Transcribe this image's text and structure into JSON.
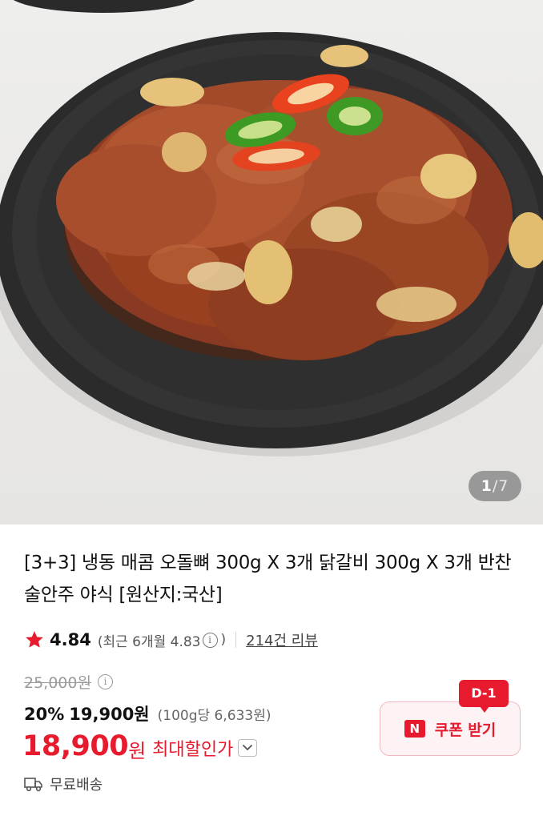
{
  "gallery": {
    "current": "1",
    "separator": "/",
    "total": "7",
    "icon": "product-photo"
  },
  "product": {
    "title": "[3+3] 냉동 매콤 오돌뼈 300g X 3개 닭갈비 300g X 3개 반찬 술안주 야식 [원산지:국산]"
  },
  "rating": {
    "icon": "star-icon",
    "value": "4.84",
    "recent_prefix": "(최근 6개월 4.83",
    "recent_suffix": ")",
    "review_link": "214건 리뷰",
    "star_color": "#e81a2e"
  },
  "price": {
    "original": "25,000원",
    "discount_percent": "20%",
    "discount_price": "19,900원",
    "unit_price": "(100g당 6,633원)",
    "final_amount": "18,900",
    "final_unit": "원",
    "max_discount_label": "최대할인가",
    "accent_color": "#e81a2e"
  },
  "coupon": {
    "logo_text": "N",
    "label": "쿠폰 받기",
    "badge": "D-1"
  },
  "shipping": {
    "icon": "truck-icon",
    "label": "무료배송"
  }
}
